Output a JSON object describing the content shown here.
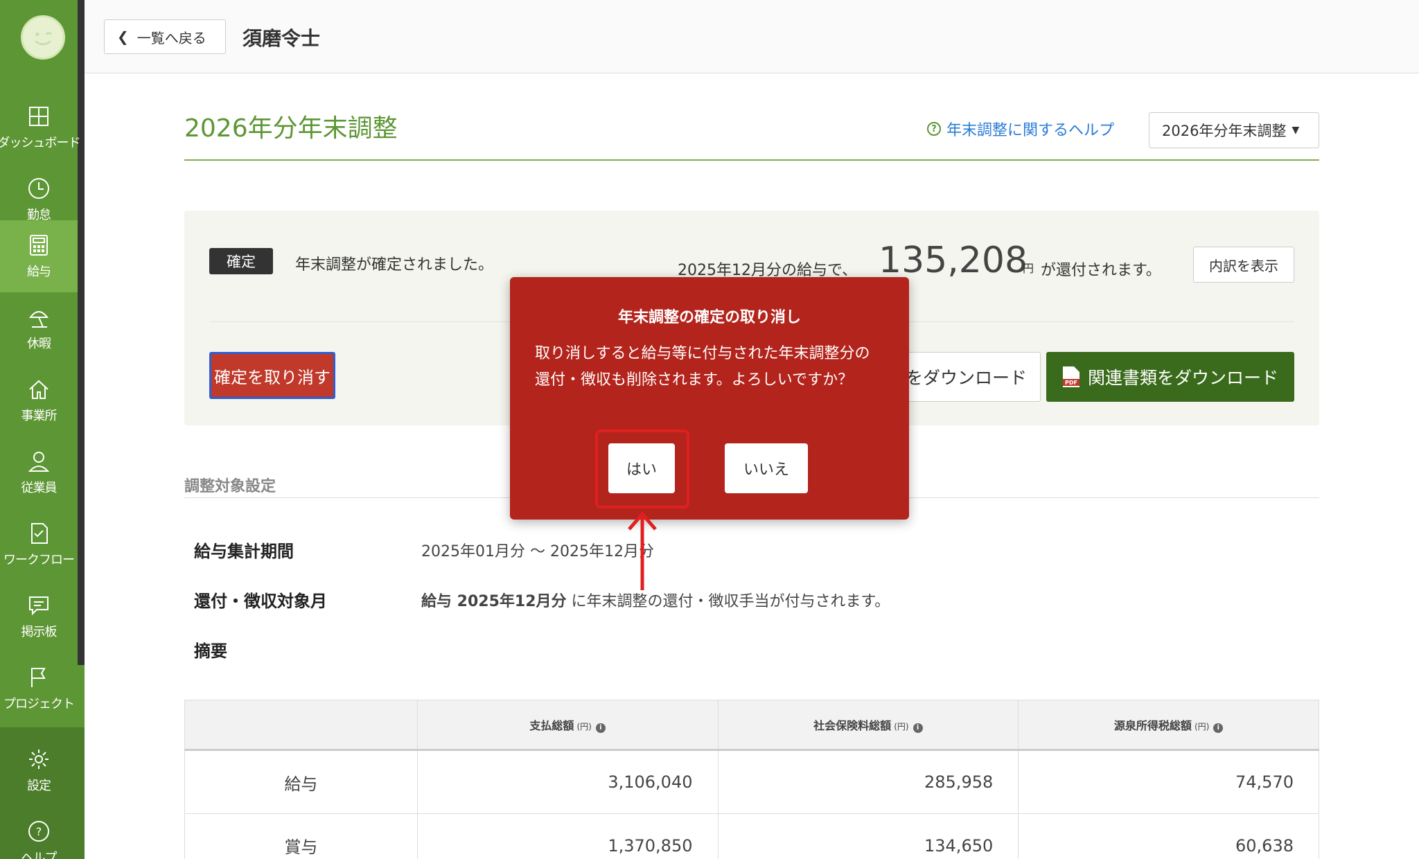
{
  "sidebar": {
    "items": [
      {
        "label": "ダッシュボード",
        "icon": "dashboard-icon"
      },
      {
        "label": "勤怠",
        "icon": "clock-icon"
      },
      {
        "label": "給与",
        "icon": "calculator-icon"
      },
      {
        "label": "休暇",
        "icon": "parasol-icon"
      },
      {
        "label": "事業所",
        "icon": "home-icon"
      },
      {
        "label": "従業員",
        "icon": "person-icon"
      },
      {
        "label": "ワークフロー",
        "icon": "checklist-icon"
      },
      {
        "label": "掲示板",
        "icon": "chat-icon"
      },
      {
        "label": "プロジェクト",
        "icon": "flag-icon"
      },
      {
        "label": "設定",
        "icon": "gear-icon"
      },
      {
        "label": "ヘルプ",
        "icon": "help-icon"
      }
    ],
    "active": "給与",
    "accent": "#5d9634"
  },
  "header": {
    "back_label": "一覧へ戻る",
    "employee_name": "須磨令士"
  },
  "page": {
    "title": "2026年分年末調整",
    "help_link": "年末調整に関するヘルプ",
    "year_select": "2026年分年末調整"
  },
  "status": {
    "badge": "確定",
    "message": "年末調整が確定されました。",
    "refund_prefix": "2025年12月分の給与で、",
    "refund_amount": "135,208",
    "refund_unit": "円",
    "refund_suffix": "が還付されます。",
    "detail_button": "内訳を表示",
    "cancel_button": "確定を取り消す",
    "download_button": "をダウンロード",
    "docs_button": "関連書類をダウンロード"
  },
  "settings": {
    "section_title": "調整対象設定",
    "period_label": "給与集計期間",
    "period_value": "2025年01月分 〜 2025年12月分",
    "month_label": "還付・徴収対象月",
    "month_value_bold": "給与 2025年12月分",
    "month_value_rest": " に年末調整の還付・徴収手当が付与されます。",
    "summary_label": "摘要"
  },
  "table": {
    "headers": [
      "支払総額",
      "社会保険料総額",
      "源泉所得税総額"
    ],
    "unit": "(円)",
    "rows": [
      {
        "label": "給与",
        "values": [
          "3,106,040",
          "285,958",
          "74,570"
        ]
      },
      {
        "label": "賞与",
        "values": [
          "1,370,850",
          "134,650",
          "60,638"
        ]
      }
    ]
  },
  "modal": {
    "title": "年末調整の確定の取り消し",
    "body": "取り消しすると給与等に付与された年末調整分の還付・徴収も削除されます。よろしいですか？",
    "yes": "はい",
    "no": "いいえ",
    "color": "#b3241c"
  }
}
